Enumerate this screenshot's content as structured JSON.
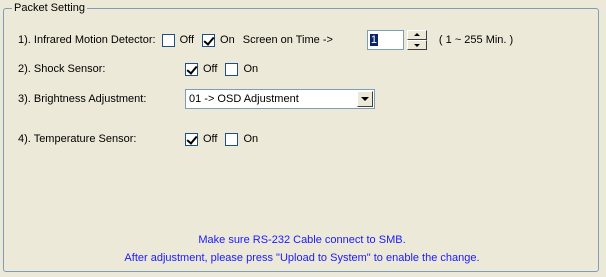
{
  "group": {
    "title": "Packet Setting"
  },
  "rows": {
    "infrared": {
      "label": "1). Infrared Motion Detector:",
      "off_label": "Off",
      "off_checked": false,
      "on_label": "On",
      "on_checked": true,
      "screen_time_label": "Screen on Time ->",
      "screen_time_value": "1",
      "range_label": "( 1 ~ 255 Min. )"
    },
    "shock": {
      "label": "2). Shock Sensor:",
      "off_label": "Off",
      "off_checked": true,
      "on_label": "On",
      "on_checked": false
    },
    "brightness": {
      "label": "3). Brightness Adjustment:",
      "selected": "01 -> OSD Adjustment"
    },
    "temperature": {
      "label": "4). Temperature Sensor:",
      "off_label": "Off",
      "off_checked": true,
      "on_label": "On",
      "on_checked": false
    }
  },
  "notice": {
    "line1": "Make sure RS-232 Cable connect to SMB.",
    "line2": "After adjustment, please press \"Upload to System\" to enable the change."
  },
  "colors": {
    "background": "#ece9d8",
    "notice_text": "#1a1aff",
    "border": "#7f9db9"
  }
}
